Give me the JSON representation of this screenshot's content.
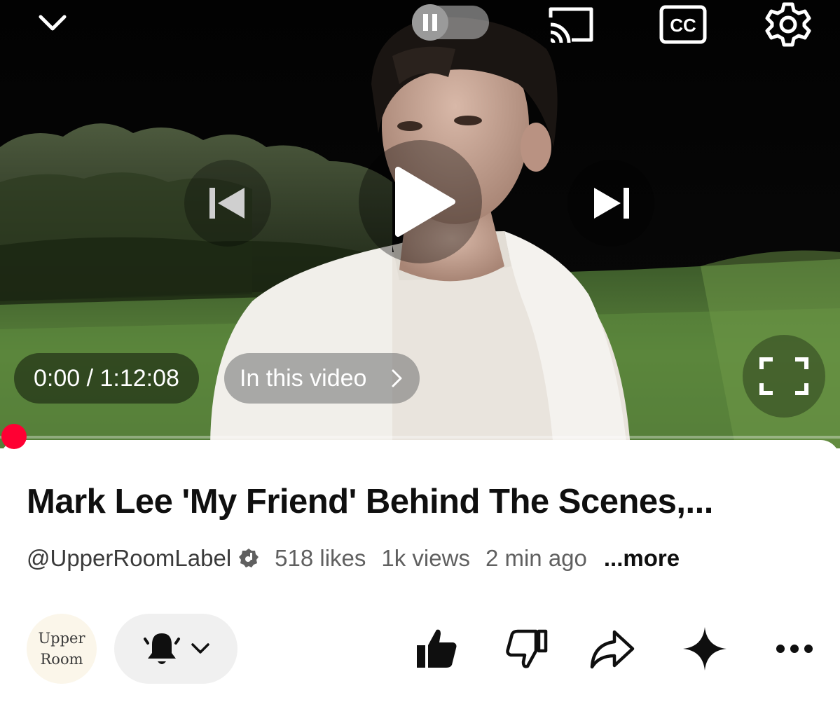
{
  "player": {
    "elapsed": "0:00",
    "duration": "1:12:08",
    "time_display": "0:00 / 1:12:08",
    "chapters_label": "In this video",
    "cc_label": "CC",
    "progress_fraction": 0.0,
    "accent_color": "#ff0033",
    "icons": {
      "collapse": "chevron-down-icon",
      "autoplay": "pause-icon",
      "cast": "cast-icon",
      "captions": "cc-icon",
      "settings": "gear-icon",
      "previous": "skip-previous-icon",
      "play": "play-icon",
      "next": "skip-next-icon",
      "fullscreen": "fullscreen-icon"
    }
  },
  "video": {
    "title": "Mark Lee 'My Friend' Behind The Scenes,...",
    "channel_handle": "@UpperRoomLabel",
    "likes": "518 likes",
    "views": "1k views",
    "age": "2 min ago",
    "more_label": "...more"
  },
  "channel": {
    "avatar_line1": "Upper",
    "avatar_line2": "Room"
  },
  "actions": {
    "icons": [
      "bell-icon",
      "chevron-down-icon",
      "thumbs-up-icon",
      "thumbs-down-icon",
      "share-icon",
      "sparkle-icon",
      "more-dots-icon"
    ]
  }
}
